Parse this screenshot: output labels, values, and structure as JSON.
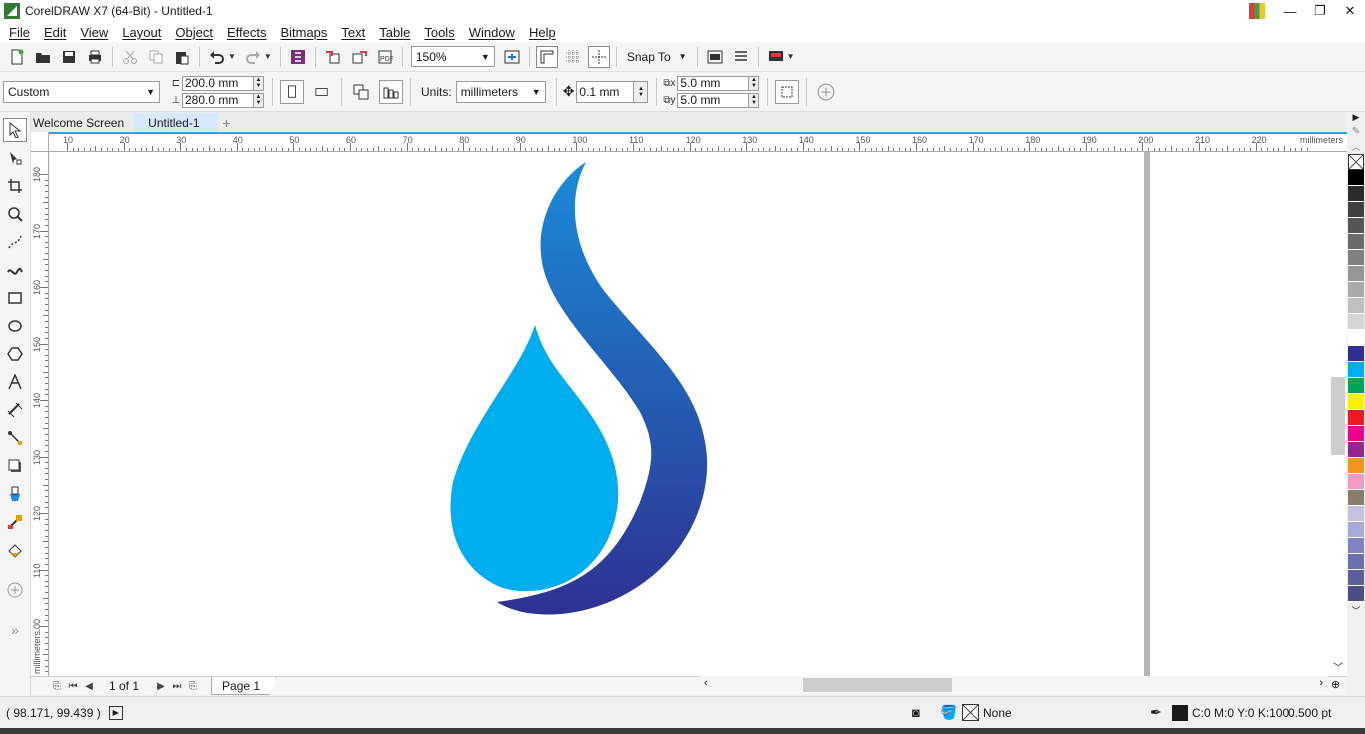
{
  "window": {
    "title": "CorelDRAW X7 (64-Bit) - Untitled-1",
    "minimize_glyph": "—",
    "restore_glyph": "❐",
    "close_glyph": "✕"
  },
  "menu": [
    "File",
    "Edit",
    "View",
    "Layout",
    "Object",
    "Effects",
    "Bitmaps",
    "Text",
    "Table",
    "Tools",
    "Window",
    "Help"
  ],
  "standard_toolbar": {
    "zoom_level": "150%",
    "snap_to_label": "Snap To"
  },
  "property_bar": {
    "page_preset": "Custom",
    "page_width": "200.0 mm",
    "page_height": "280.0 mm",
    "units_label": "Units:",
    "units_value": "millimeters",
    "nudge_value": "0.1 mm",
    "duplicate_x": "5.0 mm",
    "duplicate_y": "5.0 mm"
  },
  "doc_tabs": [
    "Welcome Screen",
    "Untitled-1"
  ],
  "rulers": {
    "unit_label": "millimeters",
    "horizontal_ticks": [
      "10",
      "20",
      "30",
      "40",
      "50",
      "60",
      "70",
      "80",
      "90",
      "100",
      "110",
      "120",
      "130",
      "140",
      "150",
      "160",
      "170",
      "180",
      "190",
      "200",
      "210",
      "220"
    ],
    "vertical_ticks": [
      "180",
      "170",
      "160",
      "150",
      "140",
      "130",
      "120",
      "110",
      "100"
    ]
  },
  "artwork": {
    "inner_drop_color": "#00AEEF",
    "swoosh_gradient_top": "#1A8BD8",
    "swoosh_gradient_bottom": "#2E3192"
  },
  "page_nav": {
    "page_count": "1 of 1",
    "page_tab": "Page 1"
  },
  "palette_colors": [
    "#000000",
    "#2b2b2b",
    "#404040",
    "#555555",
    "#6b6b6b",
    "#808080",
    "#969696",
    "#aaaaaa",
    "#c0c0c0",
    "#d6d6d6",
    "#ffffff",
    "#2e3192",
    "#00aeef",
    "#00a651",
    "#fff200",
    "#ed1c24",
    "#ec008c",
    "#92278f",
    "#f7941d",
    "#f49ac1",
    "#8b7d6b",
    "#c4c2e0",
    "#a7a9d6",
    "#7f83c3",
    "#6a6fb0",
    "#5b5f9e",
    "#4a4e86"
  ],
  "status": {
    "coordinates": "( 98.171, 99.439 )",
    "fill_label": "None",
    "outline_color": "C:0 M:0 Y:0 K:100",
    "outline_width": "0.500 pt"
  }
}
